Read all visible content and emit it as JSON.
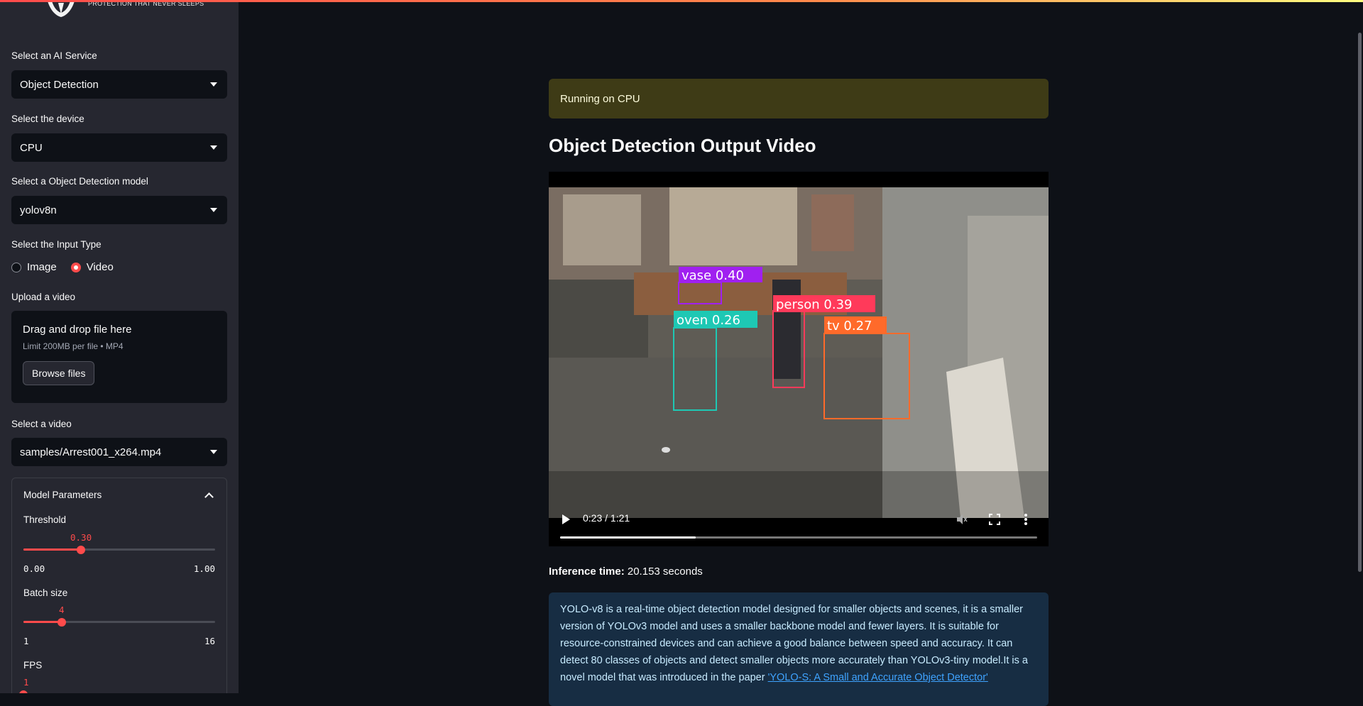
{
  "brand": {
    "tagline": "PROTECTION THAT NEVER SLEEPS"
  },
  "sidebar": {
    "service": {
      "label": "Select an AI Service",
      "value": "Object Detection"
    },
    "device": {
      "label": "Select the device",
      "value": "CPU"
    },
    "model": {
      "label": "Select a Object Detection model",
      "value": "yolov8n"
    },
    "input_type": {
      "label": "Select the Input Type",
      "options": [
        "Image",
        "Video"
      ],
      "selected": "Video"
    },
    "upload": {
      "label": "Upload a video",
      "title": "Drag and drop file here",
      "limit": "Limit 200MB per file • MP4",
      "button": "Browse files"
    },
    "video_select": {
      "label": "Select a video",
      "value": "samples/Arrest001_x264.mp4"
    },
    "params": {
      "title": "Model Parameters",
      "threshold": {
        "name": "Threshold",
        "value": "0.30",
        "min": "0.00",
        "max": "1.00",
        "fraction": 0.3
      },
      "batch": {
        "name": "Batch size",
        "value": "4",
        "min": "1",
        "max": "16",
        "fraction": 0.2
      },
      "fps": {
        "name": "FPS",
        "value": "1",
        "fraction": 0.0
      }
    }
  },
  "main": {
    "alert": "Running on CPU",
    "heading": "Object Detection Output Video",
    "video": {
      "time": "0:23 / 1:21",
      "progress": 0.284,
      "detections": [
        {
          "label": "vase 0.40",
          "color": "#a020f0"
        },
        {
          "label": "oven 0.26",
          "color": "#1ec8b4"
        },
        {
          "label": "person 0.39",
          "color": "#ff3a5a"
        },
        {
          "label": "tv 0.27",
          "color": "#ff6a2a"
        }
      ]
    },
    "inference": {
      "label": "Inference time:",
      "value": "20.153 seconds"
    },
    "info": {
      "text": "YOLO-v8 is a real-time object detection model designed for smaller objects and scenes, it is a smaller version of YOLOv3 model and uses a smaller backbone model and fewer layers. It is suitable for resource-constrained devices and can achieve a good balance between speed and accuracy. It can detect 80 classes of objects and detect smaller objects more accurately than YOLOv3-tiny model.It is a novel model that was introduced in the paper ",
      "link": "'YOLO-S: A Small and Accurate Object Detector'"
    }
  }
}
